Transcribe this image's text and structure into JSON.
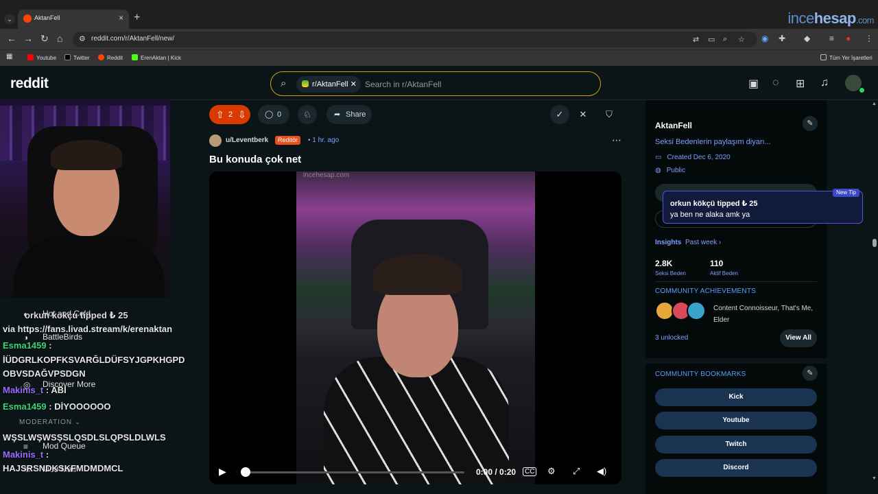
{
  "browser": {
    "tab_title": "AktanFell",
    "url": "reddit.com/r/AktanFell/new/",
    "watermark": {
      "pre": "ince",
      "bold": "hesap",
      "post": ".com"
    },
    "bookmarks": [
      {
        "label": "Youtube",
        "color": "#ff0000"
      },
      {
        "label": "Twitter",
        "color": "#000000"
      },
      {
        "label": "Reddit",
        "color": "#ff4500"
      },
      {
        "label": "ErenAktan | Kick",
        "color": "#53fc18"
      }
    ],
    "all_bookmarks_label": "Tüm Yer İşaretleri"
  },
  "reddit": {
    "logo": "reddit",
    "search": {
      "chip_label": "r/AktanFell",
      "placeholder": "Search in r/AktanFell"
    }
  },
  "post": {
    "vote_count": "2",
    "comment_count": "0",
    "share_label": "Share",
    "author": "u/Leventberk",
    "flair": "Reditör",
    "age": "1 hr. ago",
    "title": "Bu konuda çok net",
    "video": {
      "watermark": "incehesap.com",
      "time": "0:00 / 0:20",
      "progress": 0
    }
  },
  "sidebar": {
    "community_name": "AktanFell",
    "description": "Seksi Bedenlerin paylaşım diyarı...",
    "created": "Created Dec 6, 2020",
    "visibility": "Public",
    "tip": {
      "badge": "New Tip",
      "line1": "orkun kökçü tipped ₺ 25",
      "line2": "ya ben ne alaka amk ya"
    },
    "insights_label": "Insights",
    "insights_period": "Past week",
    "stats": [
      {
        "value": "2.8K",
        "label": "Seksi Beden"
      },
      {
        "value": "110",
        "label": "Aktif Beden"
      }
    ],
    "achievements_heading": "COMMUNITY ACHIEVEMENTS",
    "achievements_text": "Content Connoisseur, That's Me, Elder",
    "unlocked": "3 unlocked",
    "view_all": "View All",
    "bookmarks_heading": "COMMUNITY BOOKMARKS",
    "bookmarks": [
      "Kick",
      "Youtube",
      "Twitch",
      "Discord"
    ]
  },
  "overlay": {
    "chat": [
      {
        "user": "",
        "text": "orkun kokçu tipped ₺ 25"
      },
      {
        "user": "",
        "text": "via https://fans.livad.stream/k/erenaktan"
      },
      {
        "user": "Esma1459",
        "text": ":"
      },
      {
        "user": "",
        "text": "İÜDGRLKOPFKSVARĞLDÜFSYJGPKHGPD"
      },
      {
        "user": "",
        "text": "OBVSDAĞVPSDGN"
      },
      {
        "user": "Makinis_t",
        "text": ": ABI"
      },
      {
        "user": "Esma1459",
        "text": ": DİYOOOOOO"
      },
      {
        "user": "",
        "text": "WŞSLWŞWSŞSLQSDLSLQPSLDLWLS"
      },
      {
        "user": "Makinis_t",
        "text": ":"
      },
      {
        "user": "",
        "text": "HAJSRSNDKSKFMDMDMCL"
      }
    ],
    "side_items": [
      "Hot and Cold",
      "BattleBirds",
      "Discover More",
      "Mod Queue",
      "Mod Mail"
    ],
    "moderation_label": "MODERATION"
  }
}
